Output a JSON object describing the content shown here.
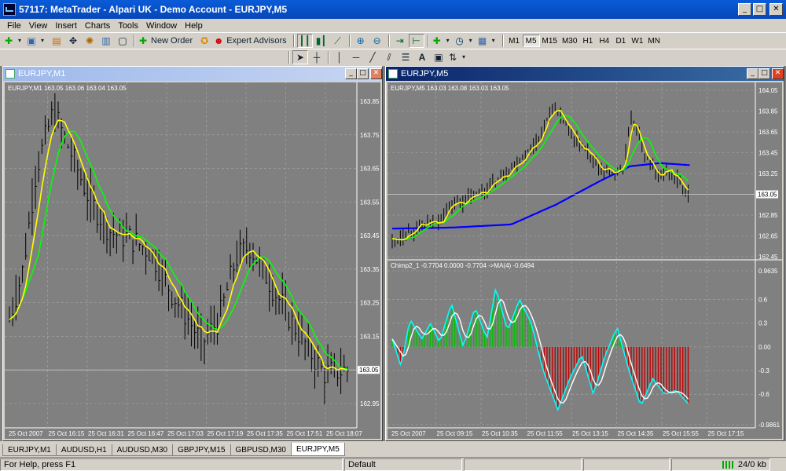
{
  "window": {
    "title": "57117: MetaTrader - Alpari UK - Demo Account - EURJPY,M5",
    "minimize": "_",
    "maximize": "□",
    "close": "✕"
  },
  "menu": [
    "File",
    "View",
    "Insert",
    "Charts",
    "Tools",
    "Window",
    "Help"
  ],
  "toolbar": {
    "new_order": "New Order",
    "expert_advisors": "Expert Advisors",
    "timeframes": [
      "M1",
      "M5",
      "M15",
      "M30",
      "H1",
      "H4",
      "D1",
      "W1",
      "MN"
    ],
    "active_timeframe": "M5",
    "text_tool": "A"
  },
  "chart1": {
    "window_title": "EURJPY,M1",
    "info": "EURJPY,M1  163.05 163.06 163.04 163.05",
    "current_price": "163.05",
    "price_labels": [
      "163.85",
      "163.75",
      "163.65",
      "163.55",
      "163.45",
      "163.35",
      "163.25",
      "163.15",
      "163.05",
      "162.95"
    ],
    "time_labels": [
      "25 Oct 2007",
      "25 Oct 16:15",
      "25 Oct 16:31",
      "25 Oct 16:47",
      "25 Oct 17:03",
      "25 Oct 17:19",
      "25 Oct 17:35",
      "25 Oct 17:51",
      "25 Oct 18:07"
    ]
  },
  "chart2": {
    "window_title": "EURJPY,M5",
    "info": "EURJPY,M5  163.03 163.08 163.03 163.05",
    "current_price": "163.05",
    "price_labels": [
      "164.05",
      "163.85",
      "163.65",
      "163.45",
      "163.25",
      "162.85",
      "162.65",
      "162.45"
    ],
    "indicator_info": "Chimp2_1 -0.7704 0.0000 -0.7704  ->MA(4) -0.6494",
    "indicator_labels": [
      "0.9635",
      "0.6",
      "0.3",
      "0.00",
      "-0.3",
      "-0.6",
      "-0.9861"
    ],
    "time_labels": [
      "25 Oct 2007",
      "25 Oct 09:15",
      "25 Oct 10:35",
      "25 Oct 11:55",
      "25 Oct 13:15",
      "25 Oct 14:35",
      "25 Oct 15:55",
      "25 Oct 17:15"
    ]
  },
  "colors": {
    "chart_bg": "#808080",
    "candles": "#000000",
    "ma_yellow": "#ffff00",
    "ma_green": "#00ff00",
    "ma_blue": "#0000ff",
    "osc_cyan": "#00ffff",
    "hist_pos": "#00c000",
    "hist_neg": "#c00000",
    "grid": "#a8a8a8"
  },
  "tabs": [
    "EURJPY,M1",
    "AUDUSD,H1",
    "AUDUSD,M30",
    "GBPJPY,M15",
    "GBPUSD,M30",
    "EURJPY,M5"
  ],
  "active_tab": "EURJPY,M5",
  "status": {
    "help": "For Help, press F1",
    "profile": "Default",
    "traffic": "24/0 kb"
  }
}
